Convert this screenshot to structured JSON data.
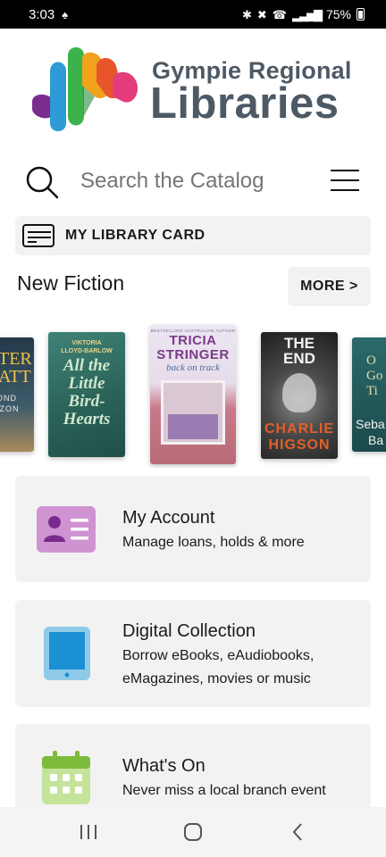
{
  "status_bar": {
    "time": "3:03",
    "battery": "75%",
    "icons": [
      "notification-icon",
      "bluetooth-icon",
      "mute-icon",
      "wifi-call-icon",
      "signal-icon",
      "battery-icon"
    ]
  },
  "header": {
    "logo_line1": "Gympie Regional",
    "logo_line2": "Libraries",
    "logo_colors": [
      "#7b2d8e",
      "#2e9ad6",
      "#3bb34a",
      "#f0a21c",
      "#e8552a",
      "#e23d7a"
    ]
  },
  "search": {
    "placeholder": "Search the Catalog",
    "icon": "search-icon",
    "menu_icon": "hamburger-menu-icon"
  },
  "library_card": {
    "label": "MY LIBRARY CARD",
    "icon": "library-card-icon"
  },
  "new_fiction": {
    "title": "New Fiction",
    "more_label": "MORE >",
    "books": [
      {
        "cover_lines": [
          "TER",
          "ATT",
          "OND",
          "IZON"
        ],
        "color": "#2d4a5e"
      },
      {
        "cover_lines": [
          "VIKTORIA",
          "LLOYD-BARLOW",
          "All the",
          "Little",
          "Bird-",
          "Hearts"
        ],
        "color": "#2f6b63"
      },
      {
        "cover_lines": [
          "BESTSELLING AUSTRALIAN AUTHOR",
          "TRICIA",
          "STRINGER",
          "back on track"
        ],
        "color": "#e8e4f0"
      },
      {
        "cover_lines": [
          "THE",
          "END",
          "CHARLIE",
          "HIGSON"
        ],
        "color": "#3a3a3a"
      },
      {
        "cover_lines": [
          "O",
          "Go",
          "Ti",
          "Seba",
          "Ba"
        ],
        "color": "#1f4f52"
      }
    ]
  },
  "tiles": [
    {
      "title": "My Account",
      "desc": "Manage loans, holds & more",
      "icon": "account-card-icon",
      "color": "#c98fd0"
    },
    {
      "title": "Digital Collection",
      "desc": "Borrow eBooks, eAudiobooks, eMagazines, movies or music",
      "icon": "tablet-icon",
      "color": "#2b9ad8"
    },
    {
      "title": "What's On",
      "desc": "Never miss a local branch event",
      "icon": "calendar-icon",
      "color": "#8cc63f"
    }
  ],
  "nav_bar": {
    "icons": [
      "recent-apps-icon",
      "home-icon",
      "back-icon"
    ]
  }
}
